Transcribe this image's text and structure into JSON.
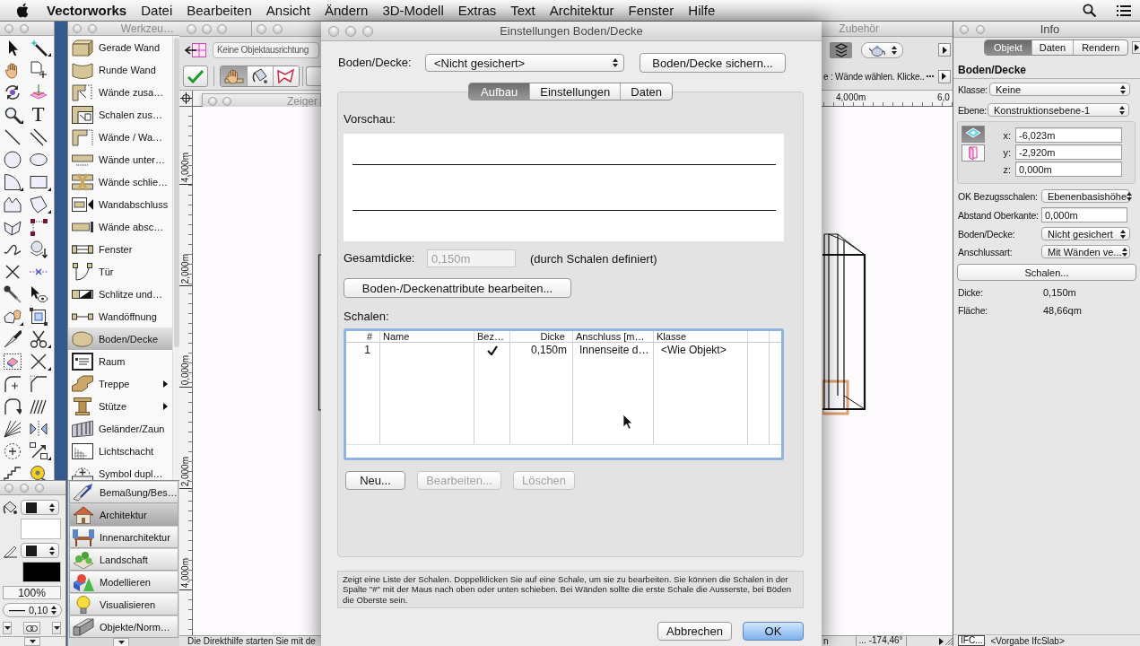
{
  "menu_bar": {
    "app": "Vectorworks",
    "menus": [
      "Datei",
      "Bearbeiten",
      "Ansicht",
      "Ändern",
      "3D-Modell",
      "Extras",
      "Text",
      "Architektur",
      "Fenster",
      "Hilfe"
    ]
  },
  "tool_palette": {
    "tools": [
      {
        "kind": "pointer",
        "flyout": false
      },
      {
        "kind": "magic-wand",
        "flyout": true
      },
      {
        "kind": "hand",
        "flyout": false
      },
      {
        "kind": "page-move",
        "flyout": false
      },
      {
        "kind": "orbit",
        "flyout": false
      },
      {
        "kind": "plane",
        "flyout": false
      },
      {
        "kind": "zoom",
        "flyout": true
      },
      {
        "kind": "text",
        "glyph": "T",
        "flyout": false
      },
      {
        "kind": "line",
        "flyout": false
      },
      {
        "kind": "double-line",
        "flyout": false
      },
      {
        "kind": "circle",
        "flyout": false
      },
      {
        "kind": "ellipse",
        "flyout": false
      },
      {
        "kind": "pie",
        "flyout": true
      },
      {
        "kind": "rectangle",
        "flyout": true
      },
      {
        "kind": "zigzag",
        "flyout": false
      },
      {
        "kind": "polygon",
        "flyout": true
      },
      {
        "kind": "folded",
        "flyout": false
      },
      {
        "kind": "polyline",
        "flyout": false
      },
      {
        "kind": "curve",
        "flyout": false
      },
      {
        "kind": "sphere",
        "flyout": false
      },
      {
        "kind": "cross",
        "flyout": false
      },
      {
        "kind": "dashed-line",
        "flyout": false
      },
      {
        "kind": "eyedropper",
        "flyout": false
      },
      {
        "kind": "pointer-eye",
        "flyout": false
      },
      {
        "kind": "reshape",
        "flyout": true
      },
      {
        "kind": "crop",
        "flyout": false
      },
      {
        "kind": "knife",
        "flyout": false
      },
      {
        "kind": "scissors",
        "flyout": true
      },
      {
        "kind": "eraser",
        "flyout": false
      },
      {
        "kind": "x-lines",
        "flyout": true
      },
      {
        "kind": "fillet",
        "flyout": false
      },
      {
        "kind": "chamfer",
        "flyout": false
      },
      {
        "kind": "arc-arrow",
        "flyout": false
      },
      {
        "kind": "hatch",
        "flyout": false
      },
      {
        "kind": "fan",
        "flyout": false
      },
      {
        "kind": "mirror",
        "flyout": false
      },
      {
        "kind": "dotted-circle",
        "flyout": false
      },
      {
        "kind": "arrow",
        "flyout": true
      },
      {
        "kind": "stairs",
        "flyout": false
      },
      {
        "kind": "tape",
        "flyout": false
      }
    ]
  },
  "tool_set": {
    "title": "Werkzeu…",
    "items": [
      {
        "label": "Gerade Wand",
        "kind": "wall",
        "selected": false,
        "submenu": false
      },
      {
        "label": "Runde Wand",
        "kind": "curved-wall",
        "selected": false,
        "submenu": false
      },
      {
        "label": "Wände zusa…",
        "kind": "wall-join",
        "selected": false,
        "submenu": false
      },
      {
        "label": "Schalen zus…",
        "kind": "component-join",
        "selected": false,
        "submenu": false
      },
      {
        "label": "Wände / Wa…",
        "kind": "wall-corner",
        "selected": false,
        "submenu": false
      },
      {
        "label": "Wände unter…",
        "kind": "wall-split",
        "selected": false,
        "submenu": false
      },
      {
        "label": "Wände schlie…",
        "kind": "wall-heal",
        "selected": false,
        "submenu": false
      },
      {
        "label": "Wandabschluss",
        "kind": "wall-cap",
        "selected": false,
        "submenu": false
      },
      {
        "label": "Wände absc…",
        "kind": "wall-end",
        "selected": false,
        "submenu": false
      },
      {
        "label": "Fenster",
        "kind": "window",
        "selected": false,
        "submenu": false
      },
      {
        "label": "Tür",
        "kind": "door",
        "selected": false,
        "submenu": false
      },
      {
        "label": "Schlitze und…",
        "kind": "slot",
        "selected": false,
        "submenu": false
      },
      {
        "label": "Wandöffnung",
        "kind": "opening",
        "selected": false,
        "submenu": false
      },
      {
        "label": "Boden/Decke",
        "kind": "slab",
        "selected": true,
        "submenu": false
      },
      {
        "label": "Raum",
        "kind": "space",
        "selected": false,
        "submenu": false
      },
      {
        "label": "Treppe",
        "kind": "stair",
        "selected": false,
        "submenu": true
      },
      {
        "label": "Stütze",
        "kind": "column",
        "selected": false,
        "submenu": true
      },
      {
        "label": "Geländer/Zaun",
        "kind": "railing",
        "selected": false,
        "submenu": false
      },
      {
        "label": "Lichtschacht",
        "kind": "skylight",
        "selected": false,
        "submenu": false
      },
      {
        "label": "Symbol dupl…",
        "kind": "symbol",
        "selected": false,
        "submenu": false
      }
    ]
  },
  "attributes": {
    "opacity": "100%",
    "line_weight": "0,10"
  },
  "palette_sets": {
    "items": [
      {
        "label": "Bemaßung/Bes…",
        "kind": "dimension",
        "selected": false
      },
      {
        "label": "Architektur",
        "kind": "architecture",
        "selected": true
      },
      {
        "label": "Innenarchitektur",
        "kind": "interior",
        "selected": false
      },
      {
        "label": "Landschaft",
        "kind": "landscape",
        "selected": false
      },
      {
        "label": "Modellieren",
        "kind": "modeling",
        "selected": false
      },
      {
        "label": "Visualisieren",
        "kind": "visualization",
        "selected": false
      },
      {
        "label": "Objekte/Norm…",
        "kind": "objects",
        "selected": false
      }
    ]
  },
  "document_window": {
    "accessories_title": "Zubehör",
    "snap_mode": "Keine Objektausrichtung",
    "modes": [
      {
        "kind": "pick",
        "selected": true
      },
      {
        "kind": "bucket",
        "selected": false
      },
      {
        "kind": "polygon",
        "selected": false
      }
    ],
    "pointer_palette": "Zeiger",
    "mode_hint": "e : Wände wählen. Klicke..",
    "h_ruler": [
      "4,000m",
      "6,0"
    ],
    "v_ruler": [
      "4,000m",
      "2,000m",
      "0,000m",
      "2,000m",
      "4,000m"
    ],
    "status": "Die Direkthilfe starten Sie mit de",
    "coordinate": "n",
    "angle": "... -174,46°"
  },
  "info_palette": {
    "title": "Info",
    "tabs": [
      {
        "label": "Objekt",
        "selected": true
      },
      {
        "label": "Daten",
        "selected": false
      },
      {
        "label": "Rendern",
        "selected": false
      }
    ],
    "object_type": "Boden/Decke",
    "class_label": "Klasse:",
    "class_value": "Keine",
    "layer_label": "Ebene:",
    "layer_value": "Konstruktionsebene-1",
    "view_modes": [
      {
        "kind": "plan",
        "selected": true
      },
      {
        "kind": "elevation",
        "selected": false
      }
    ],
    "coords": [
      {
        "label": "x:",
        "value": "-6,023m"
      },
      {
        "label": "y:",
        "value": "-2,920m"
      },
      {
        "label": "z:",
        "value": "0,000m"
      }
    ],
    "fields": [
      {
        "kind": "popup",
        "label": "OK Bezugsschalen:",
        "value": "Ebenenbasishöhe"
      },
      {
        "kind": "input",
        "label": "Abstand Oberkante:",
        "value": "0,000m"
      },
      {
        "kind": "popup",
        "label": "Boden/Decke:",
        "value": "Nicht gesichert"
      },
      {
        "kind": "popup",
        "label": "Anschlussart:",
        "value": "Mit Wänden ve..."
      }
    ],
    "components_button": "Schalen...",
    "readouts": [
      {
        "label": "Dicke:",
        "value": "0,150m"
      },
      {
        "label": "Fläche:",
        "value": "48,66qm"
      }
    ],
    "ifc_button": "IFC...",
    "ifc_value": "<Vorgabe IfcSlab>"
  },
  "dialog": {
    "title": "Einstellungen Boden/Decke",
    "style_label": "Boden/Decke:",
    "style_value": "<Nicht gesichert>",
    "save_button": "Boden/Decke sichern...",
    "tabs": [
      {
        "label": "Aufbau",
        "selected": true
      },
      {
        "label": "Einstellungen",
        "selected": false
      },
      {
        "label": "Daten",
        "selected": false
      }
    ],
    "preview_label": "Vorschau:",
    "thickness_label": "Gesamtdicke:",
    "thickness_value": "0,150m",
    "thickness_note": "(durch Schalen definiert)",
    "attributes_button": "Boden-/Deckenattribute bearbeiten...",
    "components_label": "Schalen:",
    "table": {
      "columns": [
        "#",
        "Name",
        "Bez…",
        "Dicke",
        "Anschluss [m…",
        "Klasse"
      ],
      "rows": [
        {
          "number": "1",
          "reference": true,
          "thickness": "0,150m",
          "connection": "Innenseite d…",
          "class": "<Wie Objekt>"
        }
      ]
    },
    "buttons": [
      {
        "label": "Neu...",
        "disabled": false
      },
      {
        "label": "Bearbeiten...",
        "disabled": true
      },
      {
        "label": "Löschen",
        "disabled": true
      }
    ],
    "help_text": "Zeigt eine Liste der Schalen. Doppelklicken Sie auf eine Schale, um sie zu bearbeiten. Sie können die Schalen in der Spalte \"#\" mit der Maus nach oben oder unten schieben. Bei Wänden sollte die erste Schale die Ausserste, bei Böden die Oberste sein.",
    "footer_buttons": [
      {
        "label": "Abbrechen",
        "default": false
      },
      {
        "label": "OK",
        "default": true
      }
    ]
  }
}
